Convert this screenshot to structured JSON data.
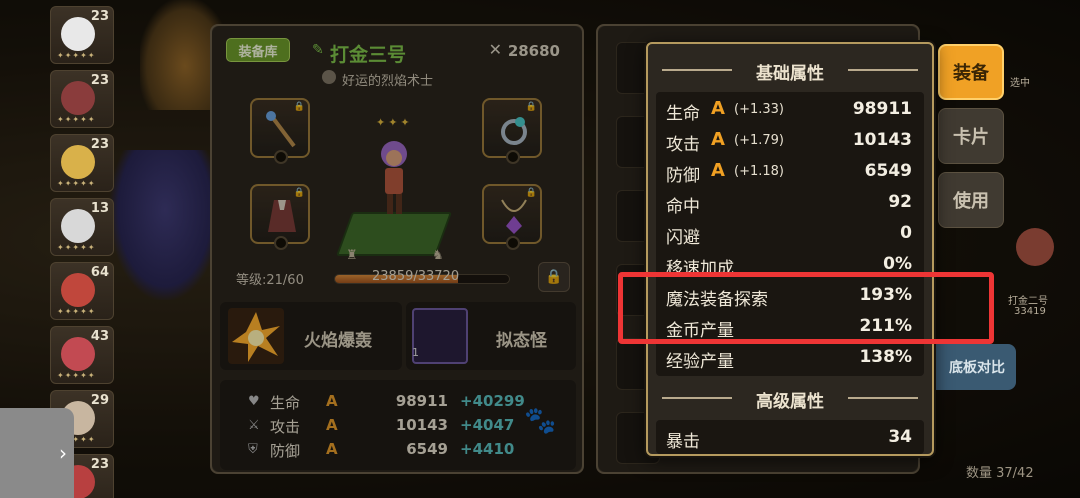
{
  "roster": [
    {
      "level": "23",
      "color": "#e8e8e8"
    },
    {
      "level": "23",
      "color": "#8a3c3c"
    },
    {
      "level": "23",
      "color": "#d9b14a"
    },
    {
      "level": "13",
      "color": "#d8d8d8"
    },
    {
      "level": "64",
      "color": "#c0473c"
    },
    {
      "level": "43",
      "color": "#c24a52"
    },
    {
      "level": "29",
      "color": "#c8b6a0"
    },
    {
      "level": "23",
      "color": "#b84040"
    }
  ],
  "equip_panel": {
    "tag_label": "装备库",
    "hero_name": "打金三号",
    "hero_title": "好运的烈焰术士",
    "power": "28680",
    "level_text": "等级:21/60",
    "xp_text": "23859/33720",
    "xp_progress": 0.708,
    "skills": [
      {
        "name": "火焰爆轰"
      },
      {
        "name": "拟态怪",
        "count": "1"
      }
    ],
    "stats": [
      {
        "icon": "heart-icon",
        "label": "生命",
        "grade": "A",
        "value": "98911",
        "bonus": "+40299"
      },
      {
        "icon": "sword-icon",
        "label": "攻击",
        "grade": "A",
        "value": "10143",
        "bonus": "+4047"
      },
      {
        "icon": "shield-icon",
        "label": "防御",
        "grade": "A",
        "value": "6549",
        "bonus": "+4410"
      }
    ]
  },
  "side_buttons": {
    "equip": "装备",
    "card": "卡片",
    "use": "使用",
    "compare": "底板对比"
  },
  "far_right": {
    "selected": "选中",
    "hero_label": "打金二号",
    "hero_power": "33419",
    "count": "数量 37/42"
  },
  "popup": {
    "basic_title": "基础属性",
    "advanced_title": "高级属性",
    "basic_attrs": [
      {
        "name": "生命",
        "grade": "A",
        "extra": "(+1.33)",
        "value": "98911"
      },
      {
        "name": "攻击",
        "grade": "A",
        "extra": "(+1.79)",
        "value": "10143"
      },
      {
        "name": "防御",
        "grade": "A",
        "extra": "(+1.18)",
        "value": "6549"
      },
      {
        "name": "命中",
        "grade": "",
        "extra": "",
        "value": "92"
      },
      {
        "name": "闪避",
        "grade": "",
        "extra": "",
        "value": "0"
      },
      {
        "name": "移速加成",
        "grade": "",
        "extra": "",
        "value": "0%"
      },
      {
        "name": "魔法装备探索",
        "grade": "",
        "extra": "",
        "value": "193%"
      },
      {
        "name": "金币产量",
        "grade": "",
        "extra": "",
        "value": "211%"
      },
      {
        "name": "经验产量",
        "grade": "",
        "extra": "",
        "value": "138%"
      }
    ],
    "advanced_attrs": [
      {
        "name": "暴击",
        "value": "34"
      }
    ]
  },
  "colors": {
    "grade": "#f0a023",
    "bonus": "#5bc0c0",
    "highlight": "#ee3535",
    "primary_button": "#f0a125"
  }
}
